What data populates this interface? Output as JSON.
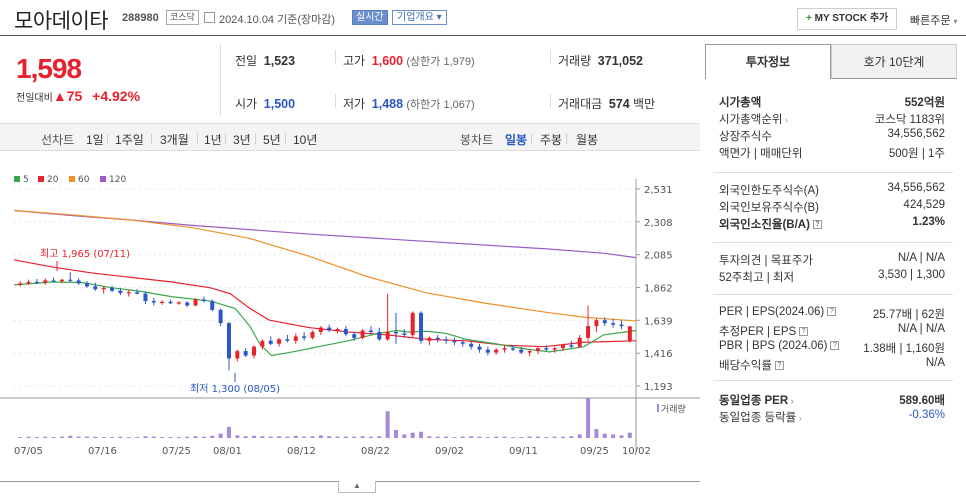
{
  "header": {
    "name": "모아데이타",
    "code": "288980",
    "market_badge": "코스닥",
    "date_text": "2024.10.04 기준(장마감)",
    "realtime_label": "실시간",
    "company_label": "기업개요",
    "mystock_label": "MY STOCK 추가",
    "quick_order": "빠른주문"
  },
  "quote": {
    "price": "1,598",
    "change_label": "전일대비",
    "change": "75",
    "change_pct": "+4.92%",
    "prev_label": "전일",
    "prev": "1,523",
    "high_label": "고가",
    "high": "1,600",
    "upper_limit": "(상한가 1,979)",
    "volume_label": "거래량",
    "volume": "371,052",
    "open_label": "시가",
    "open": "1,500",
    "low_label": "저가",
    "low": "1,488",
    "lower_limit": "(하한가 1,067)",
    "amount_label": "거래대금",
    "amount": "574",
    "amount_unit": "백만"
  },
  "periods": {
    "line_label": "선차트",
    "items": [
      "1일",
      "1주일",
      "3개월",
      "1년",
      "3년",
      "5년",
      "10년"
    ],
    "candle_label": "봉차트",
    "candle_items": [
      "일봉",
      "주봉",
      "월봉"
    ],
    "active_candle": "일봉"
  },
  "colors": {
    "up": "#e8212e",
    "down": "#2a56c6",
    "ma5": "#3aa84a",
    "ma20": "#e8212e",
    "ma60": "#f0902a",
    "ma120": "#9a5bc8",
    "volume": "#a48bd8"
  },
  "chart_data": {
    "type": "candlestick",
    "legend": [
      "5",
      "20",
      "60",
      "120"
    ],
    "y_ticks": [
      "2,531",
      "2,308",
      "2,085",
      "1,862",
      "1,639",
      "1,416",
      "1,193"
    ],
    "ylim": [
      1193,
      2531
    ],
    "x_ticks": [
      "07/05",
      "07/16",
      "07/25",
      "08/01",
      "08/12",
      "08/22",
      "09/02",
      "09/11",
      "09/25",
      "10/02"
    ],
    "high_annotation": "최고 1,965 (07/11)",
    "low_annotation": "최저 1,300 (08/05)",
    "volume_label": "거래량",
    "candles": [
      [
        1880,
        1905,
        1870,
        1890
      ],
      [
        1890,
        1915,
        1880,
        1900
      ],
      [
        1900,
        1920,
        1885,
        1895
      ],
      [
        1895,
        1925,
        1880,
        1910
      ],
      [
        1910,
        1930,
        1895,
        1905
      ],
      [
        1905,
        1920,
        1890,
        1915
      ],
      [
        1915,
        1965,
        1900,
        1910
      ],
      [
        1910,
        1925,
        1880,
        1890
      ],
      [
        1890,
        1905,
        1860,
        1870
      ],
      [
        1870,
        1895,
        1840,
        1850
      ],
      [
        1850,
        1870,
        1820,
        1860
      ],
      [
        1860,
        1875,
        1830,
        1840
      ],
      [
        1840,
        1860,
        1810,
        1825
      ],
      [
        1825,
        1845,
        1800,
        1830
      ],
      [
        1830,
        1850,
        1815,
        1820
      ],
      [
        1820,
        1835,
        1750,
        1770
      ],
      [
        1770,
        1790,
        1740,
        1760
      ],
      [
        1760,
        1775,
        1745,
        1765
      ],
      [
        1765,
        1780,
        1750,
        1755
      ],
      [
        1755,
        1770,
        1745,
        1760
      ],
      [
        1760,
        1770,
        1730,
        1740
      ],
      [
        1740,
        1790,
        1735,
        1780
      ],
      [
        1780,
        1800,
        1760,
        1770
      ],
      [
        1770,
        1780,
        1700,
        1710
      ],
      [
        1710,
        1720,
        1600,
        1620
      ],
      [
        1620,
        1630,
        1300,
        1380
      ],
      [
        1380,
        1440,
        1360,
        1430
      ],
      [
        1430,
        1450,
        1390,
        1400
      ],
      [
        1400,
        1470,
        1380,
        1460
      ],
      [
        1460,
        1510,
        1440,
        1500
      ],
      [
        1500,
        1530,
        1470,
        1480
      ],
      [
        1480,
        1520,
        1460,
        1510
      ],
      [
        1510,
        1540,
        1490,
        1500
      ],
      [
        1500,
        1550,
        1480,
        1530
      ],
      [
        1530,
        1560,
        1500,
        1520
      ],
      [
        1520,
        1570,
        1510,
        1560
      ],
      [
        1560,
        1600,
        1540,
        1590
      ],
      [
        1590,
        1610,
        1560,
        1570
      ],
      [
        1570,
        1590,
        1550,
        1580
      ],
      [
        1580,
        1600,
        1530,
        1545
      ],
      [
        1545,
        1560,
        1500,
        1520
      ],
      [
        1520,
        1580,
        1510,
        1570
      ],
      [
        1570,
        1600,
        1550,
        1560
      ],
      [
        1560,
        1590,
        1500,
        1510
      ],
      [
        1510,
        1820,
        1500,
        1560
      ],
      [
        1560,
        1690,
        1480,
        1550
      ],
      [
        1550,
        1580,
        1520,
        1540
      ],
      [
        1540,
        1700,
        1520,
        1690
      ],
      [
        1690,
        1700,
        1480,
        1500
      ],
      [
        1500,
        1530,
        1470,
        1520
      ],
      [
        1520,
        1540,
        1490,
        1510
      ],
      [
        1510,
        1530,
        1480,
        1500
      ],
      [
        1500,
        1520,
        1470,
        1490
      ],
      [
        1490,
        1510,
        1460,
        1480
      ],
      [
        1480,
        1500,
        1440,
        1460
      ],
      [
        1460,
        1480,
        1420,
        1440
      ],
      [
        1440,
        1460,
        1400,
        1420
      ],
      [
        1420,
        1450,
        1405,
        1440
      ],
      [
        1440,
        1470,
        1420,
        1450
      ],
      [
        1450,
        1470,
        1430,
        1440
      ],
      [
        1440,
        1460,
        1410,
        1420
      ],
      [
        1420,
        1440,
        1395,
        1430
      ],
      [
        1430,
        1460,
        1410,
        1450
      ],
      [
        1450,
        1470,
        1430,
        1440
      ],
      [
        1440,
        1460,
        1420,
        1450
      ],
      [
        1450,
        1480,
        1430,
        1470
      ],
      [
        1470,
        1500,
        1450,
        1460
      ],
      [
        1460,
        1540,
        1450,
        1520
      ],
      [
        1520,
        1740,
        1500,
        1600
      ],
      [
        1600,
        1650,
        1560,
        1640
      ],
      [
        1640,
        1660,
        1600,
        1620
      ],
      [
        1620,
        1650,
        1590,
        1610
      ],
      [
        1610,
        1640,
        1580,
        1600
      ],
      [
        1500,
        1600,
        1488,
        1598
      ]
    ],
    "ma120": [
      [
        0,
        2385
      ],
      [
        60,
        2350
      ],
      [
        120,
        2320
      ],
      [
        180,
        2285
      ],
      [
        240,
        2255
      ],
      [
        300,
        2225
      ],
      [
        360,
        2200
      ],
      [
        420,
        2175
      ],
      [
        480,
        2150
      ],
      [
        540,
        2125
      ],
      [
        600,
        2095
      ],
      [
        633,
        2065
      ]
    ],
    "ma60": [
      [
        0,
        2385
      ],
      [
        60,
        2355
      ],
      [
        120,
        2320
      ],
      [
        180,
        2270
      ],
      [
        240,
        2195
      ],
      [
        300,
        2075
      ],
      [
        360,
        1935
      ],
      [
        420,
        1825
      ],
      [
        480,
        1755
      ],
      [
        540,
        1695
      ],
      [
        580,
        1660
      ],
      [
        633,
        1635
      ]
    ],
    "ma20": [
      [
        0,
        2050
      ],
      [
        40,
        2000
      ],
      [
        80,
        1960
      ],
      [
        120,
        1930
      ],
      [
        160,
        1900
      ],
      [
        200,
        1860
      ],
      [
        220,
        1820
      ],
      [
        240,
        1720
      ],
      [
        260,
        1640
      ],
      [
        300,
        1590
      ],
      [
        340,
        1560
      ],
      [
        380,
        1540
      ],
      [
        420,
        1510
      ],
      [
        460,
        1500
      ],
      [
        500,
        1470
      ],
      [
        540,
        1460
      ],
      [
        580,
        1490
      ],
      [
        633,
        1500
      ]
    ],
    "ma5": [
      [
        0,
        1880
      ],
      [
        40,
        1900
      ],
      [
        70,
        1895
      ],
      [
        100,
        1860
      ],
      [
        130,
        1835
      ],
      [
        160,
        1800
      ],
      [
        200,
        1770
      ],
      [
        225,
        1720
      ],
      [
        240,
        1600
      ],
      [
        250,
        1480
      ],
      [
        262,
        1400
      ],
      [
        280,
        1420
      ],
      [
        310,
        1460
      ],
      [
        340,
        1500
      ],
      [
        370,
        1550
      ],
      [
        390,
        1570
      ],
      [
        400,
        1560
      ],
      [
        420,
        1565
      ],
      [
        440,
        1550
      ],
      [
        460,
        1510
      ],
      [
        490,
        1480
      ],
      [
        520,
        1445
      ],
      [
        545,
        1425
      ],
      [
        580,
        1460
      ],
      [
        600,
        1540
      ],
      [
        633,
        1570
      ]
    ],
    "volumes": [
      2,
      3,
      2,
      3,
      2,
      3,
      5,
      3,
      3,
      3,
      2,
      2,
      3,
      2,
      2,
      4,
      3,
      2,
      2,
      2,
      3,
      4,
      3,
      5,
      10,
      25,
      6,
      4,
      5,
      4,
      3,
      4,
      3,
      5,
      3,
      4,
      6,
      4,
      3,
      3,
      3,
      4,
      3,
      4,
      60,
      18,
      8,
      12,
      14,
      4,
      3,
      3,
      2,
      3,
      4,
      3,
      2,
      3,
      3,
      2,
      2,
      3,
      3,
      2,
      3,
      3,
      4,
      8,
      90,
      20,
      10,
      8,
      6,
      12
    ]
  },
  "info_panel": {
    "tab_active": "투자정보",
    "tab_other": "호가 10단계",
    "rows1": [
      {
        "l": "시가총액",
        "v": "552억원",
        "bold": true
      },
      {
        "l": "시가총액순위",
        "v": "코스닥 1183위",
        "arrow": true
      },
      {
        "l": "상장주식수",
        "v": "34,556,562"
      },
      {
        "l": "액면가 | 매매단위",
        "v": "500원 | 1주"
      }
    ],
    "rows2": [
      {
        "l": "외국인한도주식수(A)",
        "v": "34,556,562"
      },
      {
        "l": "외국인보유주식수(B)",
        "v": "424,529"
      },
      {
        "l": "외국인소진율(B/A)",
        "v": "1.23%",
        "bold": true,
        "q": true
      }
    ],
    "rows3": [
      {
        "l": "투자의견 | 목표주가",
        "v": "N/A | N/A"
      },
      {
        "l": "52주최고 | 최저",
        "v": "3,530 | 1,300"
      }
    ],
    "rows4": [
      {
        "l": "PER | EPS(2024.06)",
        "v": "25.77배 | 62원",
        "q": true
      },
      {
        "l": "추정PER | EPS",
        "v": "N/A | N/A",
        "q": true
      },
      {
        "l": "PBR | BPS (2024.06)",
        "v": "1.38배 | 1,160원",
        "q": true
      },
      {
        "l": "배당수익률",
        "v": "N/A",
        "q": true
      }
    ],
    "rows5": [
      {
        "l": "동일업종 PER",
        "v": "589.60배",
        "bold": true,
        "arrow": true
      },
      {
        "l": "동일업종 등락률",
        "v": "-0.36%",
        "arrow": true,
        "vcolor": "#2a56c6"
      }
    ]
  }
}
